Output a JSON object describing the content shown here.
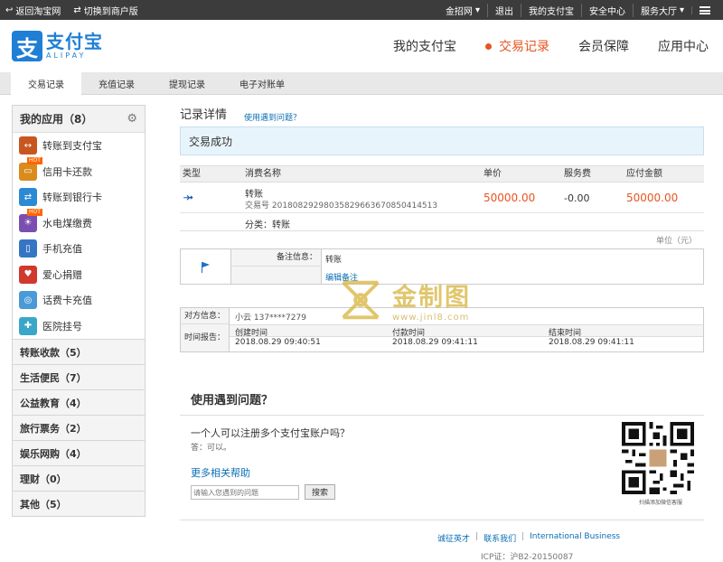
{
  "topbar": {
    "back_taobao": "返回淘宝网",
    "switch_merchant": "切换到商户版",
    "jinzhao": "金招网",
    "logout": "退出",
    "my_alipay": "我的支付宝",
    "security": "安全中心",
    "service": "服务大厅"
  },
  "logo": {
    "cn": "支付宝",
    "en": "ALIPAY",
    "mark": "支"
  },
  "nav": {
    "items": [
      {
        "label": "我的支付宝"
      },
      {
        "label": "交易记录"
      },
      {
        "label": "会员保障"
      },
      {
        "label": "应用中心"
      }
    ]
  },
  "subnav": {
    "items": [
      {
        "label": "交易记录"
      },
      {
        "label": "充值记录"
      },
      {
        "label": "提现记录"
      },
      {
        "label": "电子对账单"
      }
    ]
  },
  "sidebar": {
    "title": "我的应用（8）",
    "apps": [
      {
        "label": "转账到支付宝",
        "color": "#c8561f",
        "glyph": "↔"
      },
      {
        "label": "信用卡还款",
        "color": "#d98b1c",
        "glyph": "▭",
        "badge": "HOT"
      },
      {
        "label": "转账到银行卡",
        "color": "#2b8ad4",
        "glyph": "⇄"
      },
      {
        "label": "水电煤缴费",
        "color": "#7a4fb0",
        "glyph": "☀",
        "badge": "HOT"
      },
      {
        "label": "手机充值",
        "color": "#3576c4",
        "glyph": "▯"
      },
      {
        "label": "爱心捐赠",
        "color": "#d0392b",
        "glyph": "♥"
      },
      {
        "label": "话费卡充值",
        "color": "#4a9ad8",
        "glyph": "◎"
      },
      {
        "label": "医院挂号",
        "color": "#3aa6c9",
        "glyph": "✚"
      }
    ],
    "groups": [
      {
        "label": "转账收款（5）"
      },
      {
        "label": "生活便民（7）"
      },
      {
        "label": "公益教育（4）"
      },
      {
        "label": "旅行票务（2）"
      },
      {
        "label": "娱乐网购（4）"
      },
      {
        "label": "理财（0）"
      },
      {
        "label": "其他（5）"
      }
    ]
  },
  "content": {
    "title": "记录详情",
    "help_link": "使用遇到问题？",
    "status": "交易成功",
    "table": {
      "headers": {
        "type": "类型",
        "name": "消费名称",
        "price": "单价",
        "fee": "服务费",
        "pay": "应付金额"
      },
      "row": {
        "name": "转账",
        "trade_no": "交易号 2018082929803582966367085041451​3",
        "price": "50000.00",
        "fee": "-0.00",
        "pay": "50000.00"
      },
      "category": "分类：转账"
    },
    "unit": "单位（元）",
    "note": {
      "label": "备注信息：",
      "value": "转账",
      "edit": "编辑备注"
    },
    "party": {
      "label": "对方信息：",
      "value": "小云 137****7279",
      "time_label": "时间报告：",
      "time_headers": [
        "创建时间",
        "付款时间",
        "结束时间"
      ],
      "time_values": [
        "2018.08.29 09:40:51",
        "2018.08.29 09:41:11",
        "2018.08.29 09:41:11"
      ]
    }
  },
  "faq": {
    "title": "使用遇到问题？",
    "question": "一个人可以注册多个支付宝账户吗？",
    "answer": "答：可以。",
    "more": "更多相关帮助",
    "search_placeholder": "请输入您遇到的问题",
    "search_button": "搜索",
    "qr_caption": "扫描添加微信客服"
  },
  "footer": {
    "links": [
      "诚征英才",
      "联系我们",
      "International Business"
    ],
    "icp": "ICP证：沪B2-20150087"
  },
  "watermark": {
    "text": "金制图",
    "url": "www.jinl8.com"
  }
}
